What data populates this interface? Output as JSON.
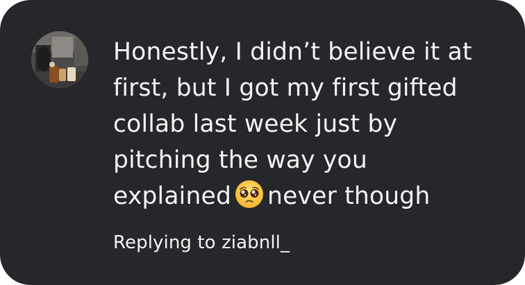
{
  "comment": {
    "avatar_icon": "profile-photo",
    "lines": [
      "Honestly, I didn’t believe it at",
      "first, but I got my first gifted",
      "collab last week just by",
      "pitching the way you"
    ],
    "last_line_before_emoji": "explained",
    "emoji_icon": "pleading-face-emoji",
    "last_line_after_emoji": "never though"
  },
  "reply": {
    "prefix": "Replying to",
    "handle": "ziabnll_"
  },
  "colors": {
    "card_background": "#25272a",
    "text": "#f4f4f4"
  }
}
